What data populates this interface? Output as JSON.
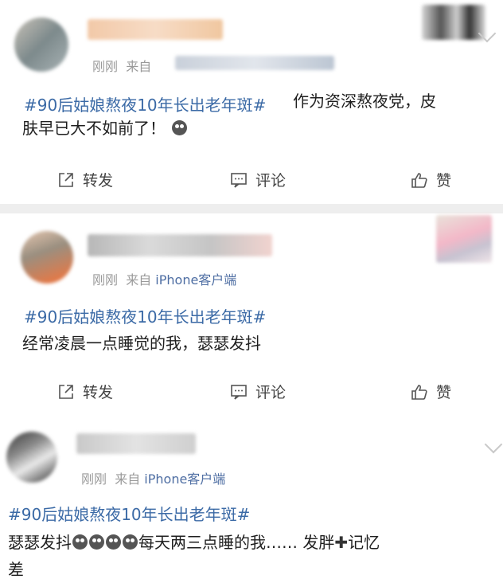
{
  "posts": [
    {
      "time": "刚刚",
      "from": "来自",
      "source": "",
      "topic": "#90后姑娘熬夜10年长出老年斑#",
      "text_line1": "作为资深熬夜党，皮",
      "text_line2": "肤早已大不如前了！"
    },
    {
      "time": "刚刚",
      "from": "来自",
      "source": "iPhone客户端",
      "topic": "#90后姑娘熬夜10年长出老年斑#",
      "text_line1": "经常凌晨一点睡觉的我，瑟瑟发抖"
    },
    {
      "time": "刚刚",
      "from": "来自",
      "source": "iPhone客户端",
      "topic": "#90后姑娘熬夜10年长出老年斑#",
      "text_line1_a": "瑟瑟发抖",
      "text_line1_b": "每天两三点睡的我…… 发胖",
      "text_line1_c": "记忆",
      "text_line2": "差"
    }
  ],
  "actions": {
    "repost": "转发",
    "comment": "评论",
    "like": "赞"
  },
  "icons": [
    "repost-icon",
    "comment-icon",
    "like-icon",
    "chevron-down-icon",
    "emoji-icon"
  ],
  "colors": {
    "topic": "#3b6aa6",
    "meta": "#9a9a9a",
    "source": "#4e6ea3",
    "divider": "#eeeeee"
  }
}
